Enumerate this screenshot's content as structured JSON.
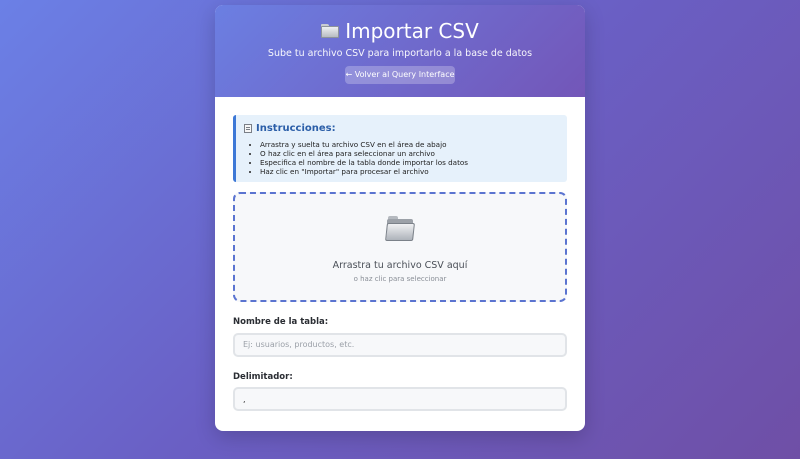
{
  "header": {
    "title": "Importar CSV",
    "subtitle": "Sube tu archivo CSV para importarlo a la base de datos",
    "back_button": "← Volver al Query Interface",
    "title_icon": "folder-icon"
  },
  "instructions": {
    "title": "Instrucciones:",
    "icon": "clipboard-icon",
    "items": [
      "Arrastra y suelta tu archivo CSV en el área de abajo",
      "O haz clic en el área para seleccionar un archivo",
      "Especifica el nombre de la tabla donde importar los datos",
      "Haz clic en \"Importar\" para procesar el archivo"
    ]
  },
  "dropzone": {
    "icon": "folder-icon",
    "main_text": "Arrastra tu archivo CSV aquí",
    "sub_text": "o haz clic para seleccionar"
  },
  "form": {
    "table_name_label": "Nombre de la tabla:",
    "table_name_placeholder": "Ej: usuarios, productos, etc.",
    "table_name_value": "",
    "delimiter_label": "Delimitador:",
    "delimiter_value": ","
  },
  "colors": {
    "accent": "#5b74d0",
    "instruction_border": "#3d78d6",
    "instruction_title": "#2b5ea8"
  }
}
